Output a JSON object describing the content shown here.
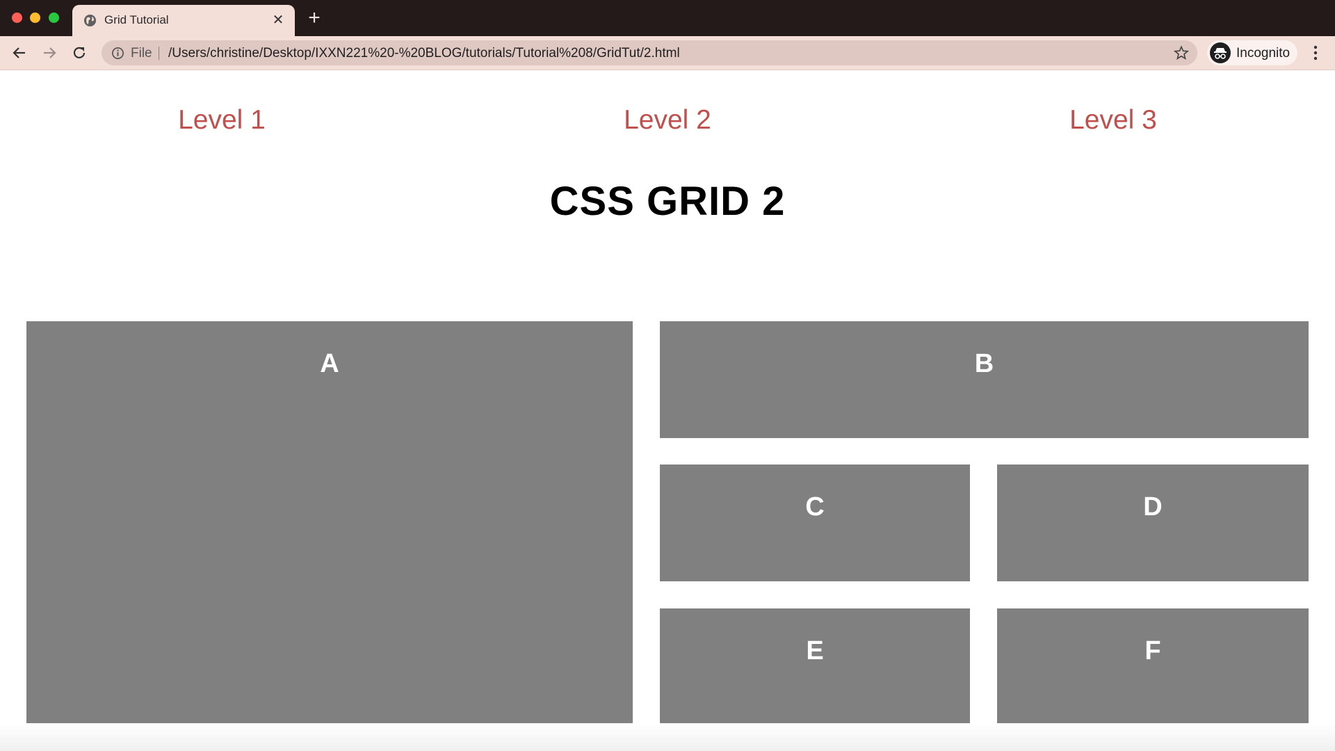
{
  "browser": {
    "tab": {
      "title": "Grid Tutorial",
      "close_glyph": "✕",
      "favicon": "globe-icon"
    },
    "new_tab_glyph": "+",
    "omnibox": {
      "scheme": "File",
      "url": "/Users/christine/Desktop/IXXN221%20-%20BLOG/tutorials/Tutorial%208/GridTut/2.html"
    },
    "profile": {
      "label": "Incognito"
    },
    "icons": [
      "back-icon",
      "forward-icon",
      "reload-icon",
      "info-icon",
      "star-icon",
      "incognito-icon",
      "menu-icon"
    ]
  },
  "page": {
    "nav": [
      "Level 1",
      "Level 2",
      "Level 3"
    ],
    "title": "CSS GRID 2",
    "grid": [
      "A",
      "B",
      "C",
      "D",
      "E",
      "F"
    ]
  },
  "colors": {
    "tabstrip": "#231a19",
    "toolbar": "#f3ded8",
    "nav_link": "#c0504d",
    "grid_cell": "#808080",
    "grid_label": "#ffffff"
  }
}
